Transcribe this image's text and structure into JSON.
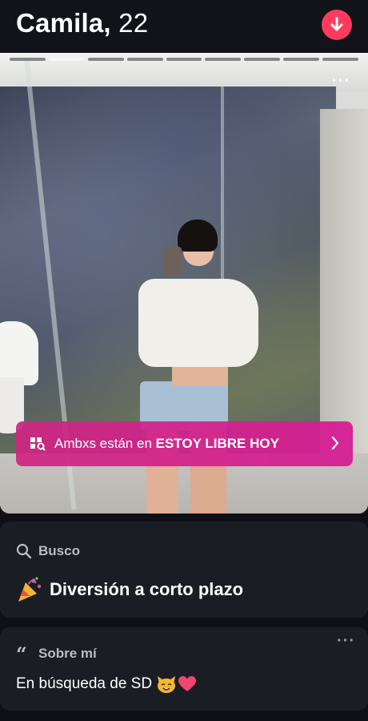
{
  "profile": {
    "name": "Camila",
    "separator": ",",
    "age": "22"
  },
  "photo": {
    "total_photos": 9,
    "current_index": 2
  },
  "banner": {
    "prefix": "Ambxs están en ",
    "highlight": "ESTOY LIBRE HOY"
  },
  "looking_for": {
    "label": "Busco",
    "emoji": "party-popper",
    "value": "Diversión a corto plazo"
  },
  "about": {
    "label": "Sobre mí",
    "text": "En búsqueda de SD"
  },
  "colors": {
    "accent": "#fe3b5f",
    "banner": "#d01e8a",
    "card": "#1a1d24",
    "background": "#0e1015"
  },
  "icons": [
    "down-arrow-icon",
    "more-icon",
    "search-icon",
    "quote-icon",
    "chevron-right-icon",
    "cat-emoji-icon",
    "heart-icon"
  ]
}
